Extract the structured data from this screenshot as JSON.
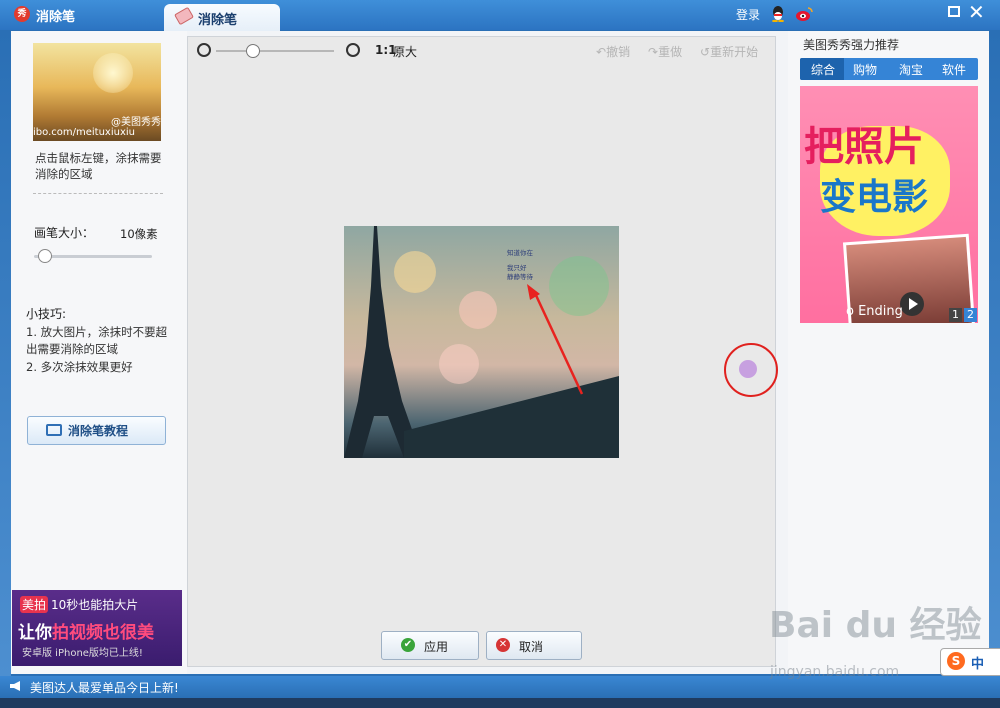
{
  "titlebar": {
    "app_title": "消除笔",
    "app_icon_label": "秀",
    "tab_label": "消除笔",
    "login_label": "登录"
  },
  "left_panel": {
    "thumbnail_watermark_handle": "@美图秀秀",
    "thumbnail_watermark_url": "ibo.com/meituxiuxiu",
    "hint": "点击鼠标左键，涂抹需要消除的区域",
    "brush_size_label": "画笔大小：",
    "brush_size_value": "10像素",
    "tips_title": "小技巧:",
    "tip_1": "1. 放大图片，涂抹时不要超出需要消除的区域",
    "tip_2": "2. 多次涂抹效果更好",
    "tutorial_button": "消除笔教程",
    "ad": {
      "badge": "美拍",
      "line1": "10秒也能拍大片",
      "line2_prefix": "让你",
      "line2_highlight": "拍视频也很美",
      "line3": "安卓版  iPhone版均已上线!"
    }
  },
  "toolbar": {
    "ratio": "1:1",
    "ratio_label": "原大",
    "undo": "撤销",
    "redo": "重做",
    "restart": "重新开始"
  },
  "photo": {
    "text_line1": "知道你在",
    "text_line2": "我只好",
    "text_line3": "静静等待"
  },
  "actions": {
    "apply": "应用",
    "cancel": "取消"
  },
  "right_panel": {
    "title": "美图秀秀强力推荐",
    "tabs": [
      "综合",
      "购物",
      "淘宝",
      "软件"
    ],
    "ad_line1": "把照片",
    "ad_line2": "变电影",
    "ad_caption": "o Ending",
    "pager": [
      "1",
      "2"
    ]
  },
  "statusbar": {
    "text": "美图达人最爱单品今日上新!"
  },
  "watermark": {
    "brand": "Bai du 经验",
    "url": "jingyan.baidu.com"
  },
  "ime": {
    "logo": "S",
    "label": "中"
  },
  "colors": {
    "accent": "#3584d6",
    "apply_green": "#3aa43a",
    "cancel_red": "#d63535",
    "cursor_ring": "#e0211e",
    "cursor_fill": "#c7a0e0"
  }
}
